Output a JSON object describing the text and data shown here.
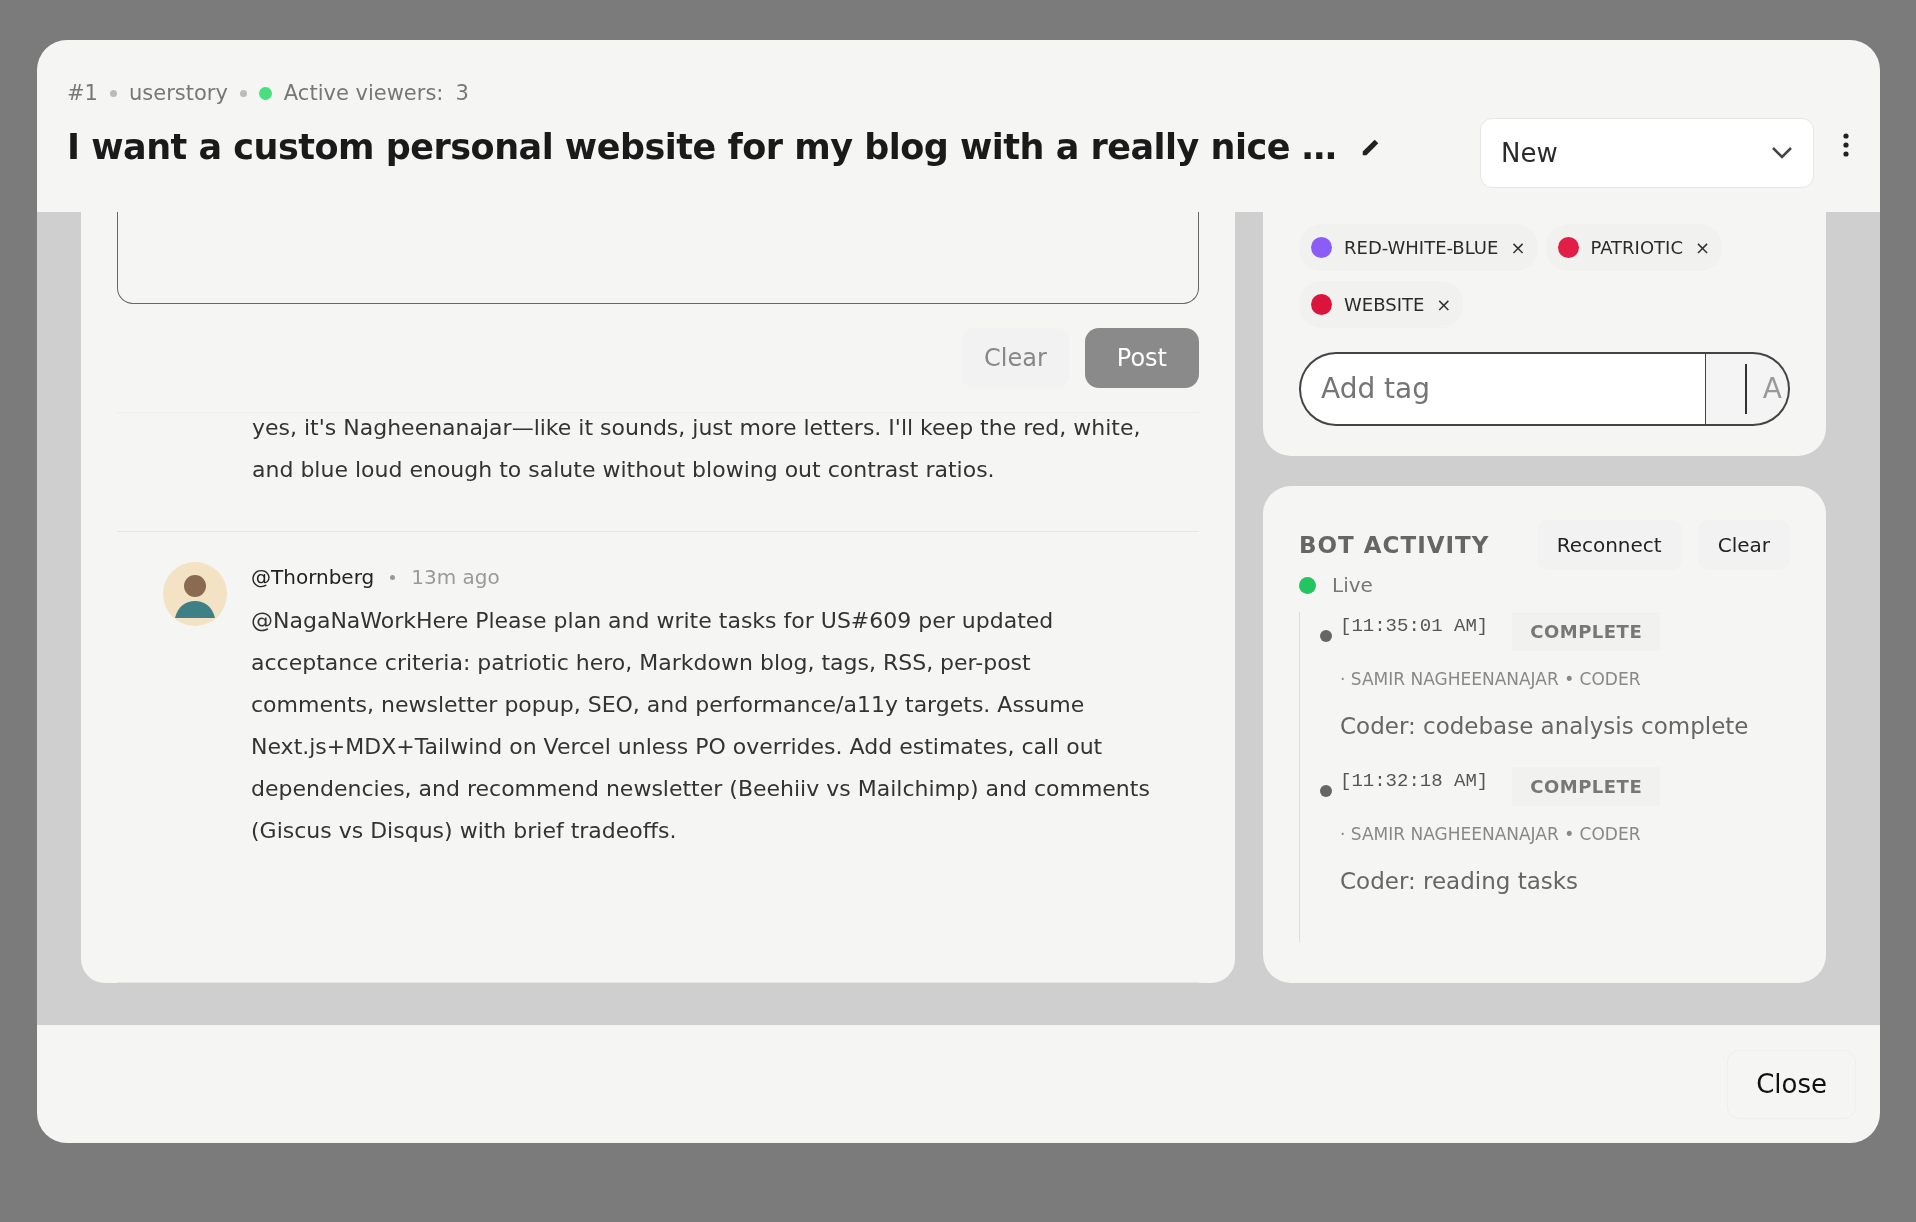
{
  "header": {
    "number": "#1",
    "type": "userstory",
    "viewers_label": "Active viewers:",
    "viewers_count": "3",
    "title": "I want a custom personal website for my blog with a really nice …",
    "status": "New"
  },
  "composer": {
    "clear": "Clear",
    "post": "Post",
    "post_disabled": true
  },
  "comments": [
    {
      "kind": "continuation",
      "text": "yes, it's Nagheenanajar—like it sounds, just more letters. I'll keep the red, white, and blue loud enough to salute without blowing out contrast ratios."
    },
    {
      "kind": "full",
      "author": "@Thornberg",
      "time": "13m ago",
      "text": "@NagaNaWorkHere Please plan and write tasks for US#609 per updated acceptance criteria: patriotic hero, Markdown blog, tags, RSS, per-post comments, newsletter popup, SEO, and performance/a11y targets. Assume Next.js+MDX+Tailwind on Vercel unless PO overrides. Add estimates, call out dependencies, and recommend newsletter (Beehiiv vs Mailchimp) and comments (Giscus vs Disqus) with brief tradeoffs."
    }
  ],
  "tags": [
    {
      "label": "RED-WHITE-BLUE",
      "color": "#8b5cf6",
      "remove": "×"
    },
    {
      "label": "PATRIOTIC",
      "color": "#e11d48",
      "remove": "×"
    },
    {
      "label": "WEBSITE",
      "color": "#dc143c",
      "remove": "×"
    }
  ],
  "tag_input": {
    "placeholder": "Add tag",
    "button": "A"
  },
  "bot_activity": {
    "title": "BOT ACTIVITY",
    "reconnect": "Reconnect",
    "clear": "Clear",
    "status": "Live",
    "events": [
      {
        "time": "[11:35:01 AM]",
        "status": "COMPLETE",
        "source": "· SAMIR NAGHEENANAJAR • CODER",
        "message": "Coder: codebase analysis complete"
      },
      {
        "time": "[11:32:18 AM]",
        "status": "COMPLETE",
        "source": "· SAMIR NAGHEENANAJAR • CODER",
        "message": "Coder: reading tasks"
      }
    ]
  },
  "footer": {
    "close": "Close"
  }
}
